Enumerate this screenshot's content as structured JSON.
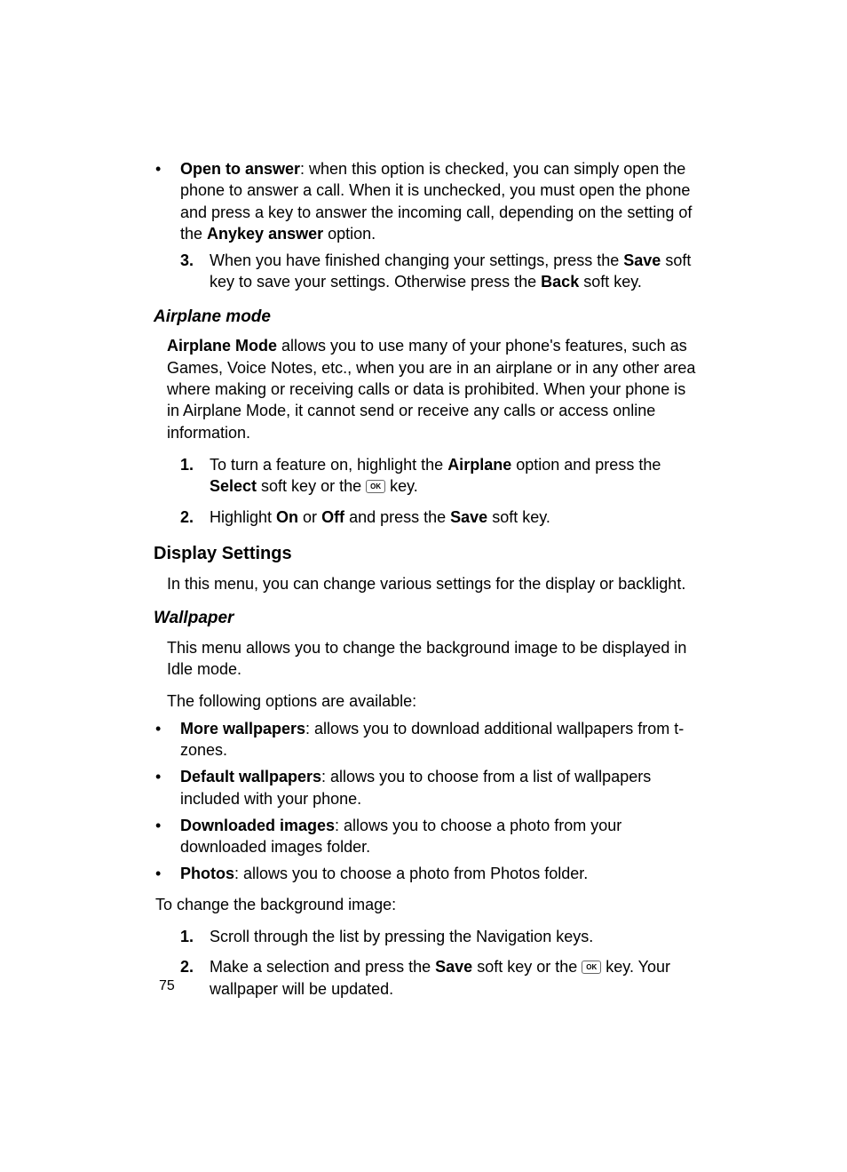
{
  "bullet1": {
    "dot": "•",
    "term": "Open to answer",
    "rest": ": when this option is checked, you can simply open the phone to answer a call. When it is unchecked, you must open the phone and press a key to answer the incoming call, depending on the setting of the ",
    "term2": "Anykey answer",
    "rest2": " option."
  },
  "ol3": {
    "num": "3.",
    "t1": "When you have finished changing your settings, press the ",
    "b1": "Save",
    "t2": " soft key to save your settings. Otherwise press the ",
    "b2": "Back",
    "t3": " soft key."
  },
  "h_airplane": "Airplane mode",
  "p_airplane": {
    "b1": "Airplane Mode",
    "t1": " allows you to use many of your phone's features, such as Games, Voice Notes, etc., when you are in an airplane or in any other area where making or receiving calls or data is prohibited. When your phone is in Airplane Mode, it cannot send or receive any calls or access online information."
  },
  "ol_a1": {
    "num": "1.",
    "t1": "To turn a feature on, highlight the ",
    "b1": "Airplane",
    "t2": " option and press the ",
    "b2": "Select",
    "t3": " soft key or the ",
    "ok": "OK",
    "t4": " key."
  },
  "ol_a2": {
    "num": "2.",
    "t1": "Highlight ",
    "b1": "On",
    "t2": " or ",
    "b2": "Off",
    "t3": " and press the ",
    "b3": "Save",
    "t4": " soft key."
  },
  "h_display": "Display Settings",
  "p_display": "In this menu, you can change various settings for the display or backlight.",
  "h_wallpaper": "Wallpaper",
  "p_wall1": "This menu allows you to change the background image to be displayed in Idle mode.",
  "p_wall2": "The following options are available:",
  "bw1": {
    "dot": "•",
    "b": "More wallpapers",
    "t": ": allows you to download additional wallpapers from t-zones."
  },
  "bw2": {
    "dot": "•",
    "b": "Default wallpapers",
    "t": ": allows you to choose from a list of wallpapers included with your phone."
  },
  "bw3": {
    "dot": "•",
    "b": "Downloaded images",
    "t": ": allows you to choose a photo from your downloaded images folder."
  },
  "bw4": {
    "dot": "•",
    "b": "Photos",
    "t": ": allows you to choose a photo from Photos folder."
  },
  "p_change": "To change the background image:",
  "ol_w1": {
    "num": "1.",
    "t": "Scroll through the list by pressing the Navigation keys."
  },
  "ol_w2": {
    "num": "2.",
    "t1": "Make a selection and press the ",
    "b1": "Save",
    "t2": " soft key or the ",
    "ok": "OK",
    "t3": " key. Your wallpaper will be updated."
  },
  "page_number": "75"
}
